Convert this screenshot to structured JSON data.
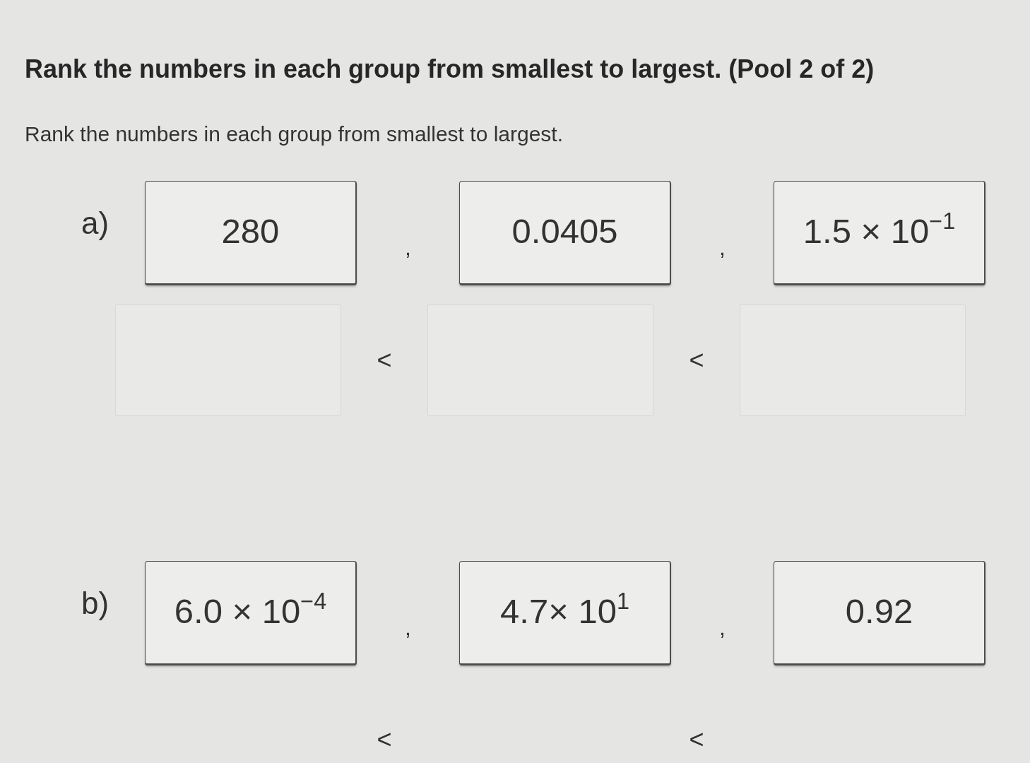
{
  "title": "Rank the numbers in each group from smallest to largest. (Pool 2 of 2)",
  "instructions": "Rank the numbers in each group from smallest to largest.",
  "groups": [
    {
      "label": "a)",
      "items": [
        "280",
        "0.0405",
        "1.5 × 10$^{−1}$"
      ],
      "item_separators": [
        ",",
        ","
      ],
      "answer": {
        "slots_shown": true,
        "separators": [
          "<",
          "<"
        ]
      }
    },
    {
      "label": "b)",
      "items": [
        "6.0 × 10$^{−4}$",
        "4.7× 10$^{1}$",
        "0.92"
      ],
      "item_separators": [
        ",",
        ","
      ],
      "answer": {
        "slots_shown": false,
        "separators": [
          "<",
          "<"
        ]
      }
    }
  ]
}
